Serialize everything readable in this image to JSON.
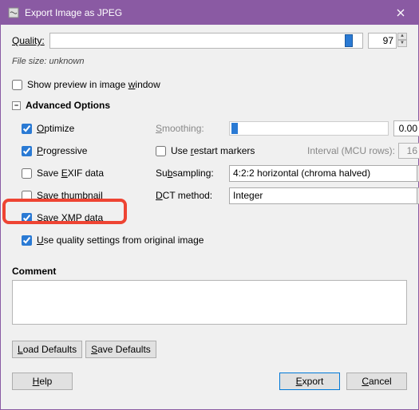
{
  "title": "Export Image as JPEG",
  "quality": {
    "label": "Quality:",
    "value": 97,
    "max": 100
  },
  "filesize": "File size: unknown",
  "show_preview": {
    "label_pre": "Show preview in image ",
    "label_key": "w",
    "label_post": "indow",
    "checked": false
  },
  "advanced_label": "Advanced Options",
  "options": {
    "optimize": {
      "label_key": "O",
      "label_rest": "ptimize",
      "checked": true
    },
    "progressive": {
      "label_key": "P",
      "label_rest": "rogressive",
      "checked": true
    },
    "exif": {
      "label_pre": "Save ",
      "label_key": "E",
      "label_mid": "XIF",
      "label_post": " data",
      "checked": false
    },
    "thumb": {
      "label_pre": "Save ",
      "label_key": "t",
      "label_post": "humbnail",
      "checked": false
    },
    "xmp": {
      "label_pre": "Save ",
      "label_key": "X",
      "label_mid": "MP",
      "label_post": " data",
      "checked": true
    },
    "orig": {
      "label_key": "U",
      "label_rest": "se quality settings from original image",
      "checked": true
    }
  },
  "right": {
    "smoothing": {
      "label_key": "S",
      "label_rest": "moothing:",
      "value": "0.00"
    },
    "restart": {
      "label_pre": "Use ",
      "label_key": "r",
      "label_post": "estart markers",
      "checked": false
    },
    "interval": {
      "label": "Interval (MCU rows):",
      "value": "16"
    },
    "subsampling": {
      "label_pre": "Su",
      "label_key": "b",
      "label_post": "sampling:",
      "selected": "4:2:2 horizontal (chroma halved)"
    },
    "dct": {
      "label_key": "D",
      "label_rest": "CT method:",
      "selected": "Integer"
    }
  },
  "comment_label": "Comment",
  "comment_value": "",
  "buttons": {
    "load_defaults": "Load Defaults",
    "save_defaults": "Save Defaults",
    "help": "Help",
    "export": "Export",
    "cancel": "Cancel"
  }
}
